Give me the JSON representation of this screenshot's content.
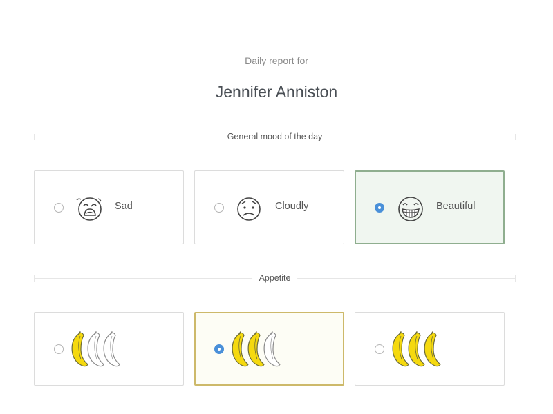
{
  "header": {
    "subtitle": "Daily report for",
    "name": "Jennifer Anniston"
  },
  "mood": {
    "section_label": "General mood of the day",
    "options": [
      {
        "label": "Sad",
        "icon": "crying-face-icon",
        "selected": false
      },
      {
        "label": "Cloudly",
        "icon": "worried-face-icon",
        "selected": false
      },
      {
        "label": "Beautiful",
        "icon": "grinning-face-icon",
        "selected": true
      }
    ]
  },
  "appetite": {
    "section_label": "Appetite",
    "options": [
      {
        "icon": "banana-icon",
        "filled_bananas": 1,
        "total_bananas": 3,
        "selected": false
      },
      {
        "icon": "banana-icon",
        "filled_bananas": 2,
        "total_bananas": 3,
        "selected": true
      },
      {
        "icon": "banana-icon",
        "filled_bananas": 3,
        "total_bananas": 3,
        "selected": false
      }
    ]
  },
  "colors": {
    "radio_selected": "#4a90d9",
    "mood_selected_border": "#8fae8f",
    "mood_selected_bg": "#f0f6f0",
    "appetite_selected_border": "#cdb96a",
    "banana_yellow": "#f5d90f",
    "banana_outline": "#6b6b3a"
  }
}
